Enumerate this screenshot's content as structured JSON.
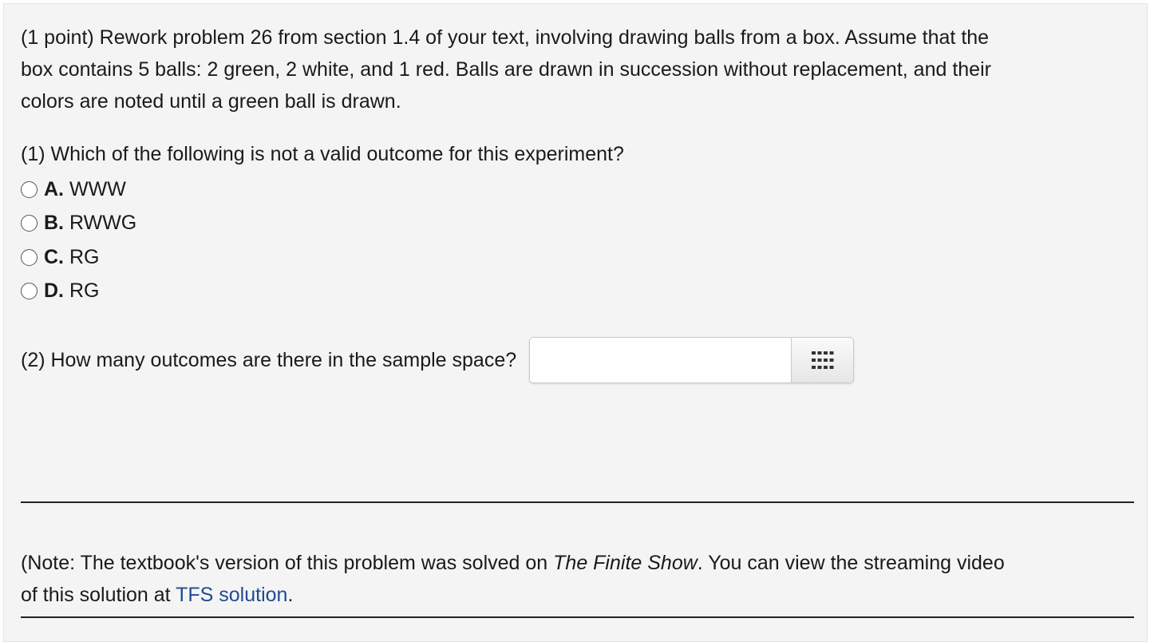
{
  "problem": {
    "intro_line1": "(1 point) Rework problem 26 from section 1.4 of your text, involving drawing balls from a box. Assume that the",
    "intro_line2": "box contains 5 balls: 2 green, 2 white, and 1 red. Balls are drawn in succession without replacement, and their",
    "intro_line3": "colors are noted until a green ball is drawn."
  },
  "question1": {
    "text": "(1) Which of the following is not a valid outcome for this experiment?",
    "options": [
      {
        "letter": "A.",
        "label": "WWW"
      },
      {
        "letter": "B.",
        "label": "RWWG"
      },
      {
        "letter": "C.",
        "label": "RG"
      },
      {
        "letter": "D.",
        "label": "RG"
      }
    ]
  },
  "question2": {
    "text": "(2) How many outcomes are there in the sample space?",
    "answer_value": "",
    "palette_icon": "grid-icon"
  },
  "note": {
    "prefix": "(Note: The textbook's version of this problem was solved on ",
    "show_title": "The Finite Show",
    "middle": ". You can view the streaming video",
    "line2_prefix": "of this solution at ",
    "link_text": "TFS solution",
    "suffix": "."
  },
  "colors": {
    "panel_bg": "#f4f4f4",
    "link": "#1f4a8f"
  }
}
